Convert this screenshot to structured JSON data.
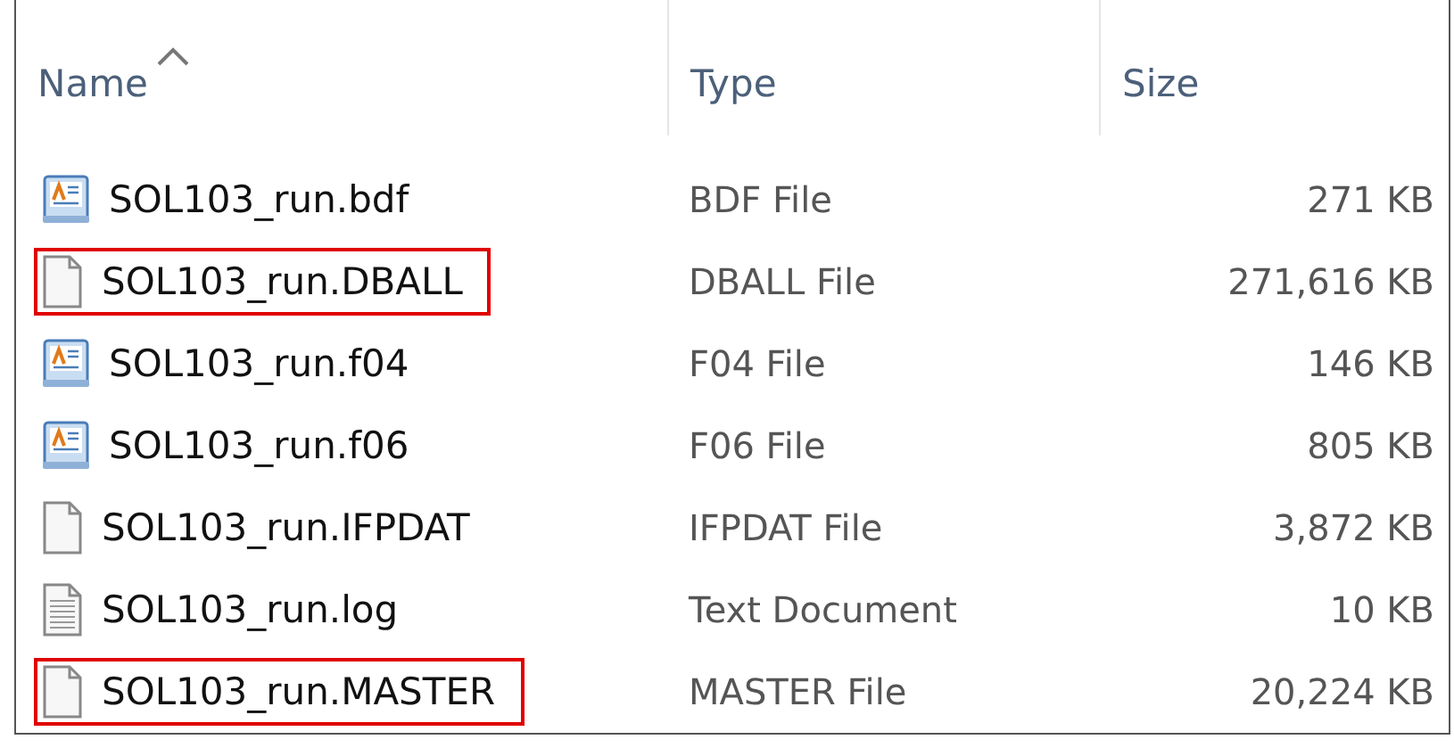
{
  "columns": [
    {
      "label": "Name",
      "sorted": true
    },
    {
      "label": "Type",
      "sorted": false
    },
    {
      "label": "Size",
      "sorted": false
    }
  ],
  "files": [
    {
      "name": "SOL103_run.bdf",
      "type": "BDF File",
      "size": "271 KB",
      "kind": "nastran",
      "highlighted": false
    },
    {
      "name": "SOL103_run.DBALL",
      "type": "DBALL File",
      "size": "271,616 KB",
      "kind": "blank",
      "highlighted": true
    },
    {
      "name": "SOL103_run.f04",
      "type": "F04 File",
      "size": "146 KB",
      "kind": "nastran",
      "highlighted": false
    },
    {
      "name": "SOL103_run.f06",
      "type": "F06 File",
      "size": "805 KB",
      "kind": "nastran",
      "highlighted": false
    },
    {
      "name": "SOL103_run.IFPDAT",
      "type": "IFPDAT File",
      "size": "3,872 KB",
      "kind": "blank",
      "highlighted": false
    },
    {
      "name": "SOL103_run.log",
      "type": "Text Document",
      "size": "10 KB",
      "kind": "text",
      "highlighted": false
    },
    {
      "name": "SOL103_run.MASTER",
      "type": "MASTER File",
      "size": "20,224 KB",
      "kind": "blank",
      "highlighted": true
    }
  ]
}
